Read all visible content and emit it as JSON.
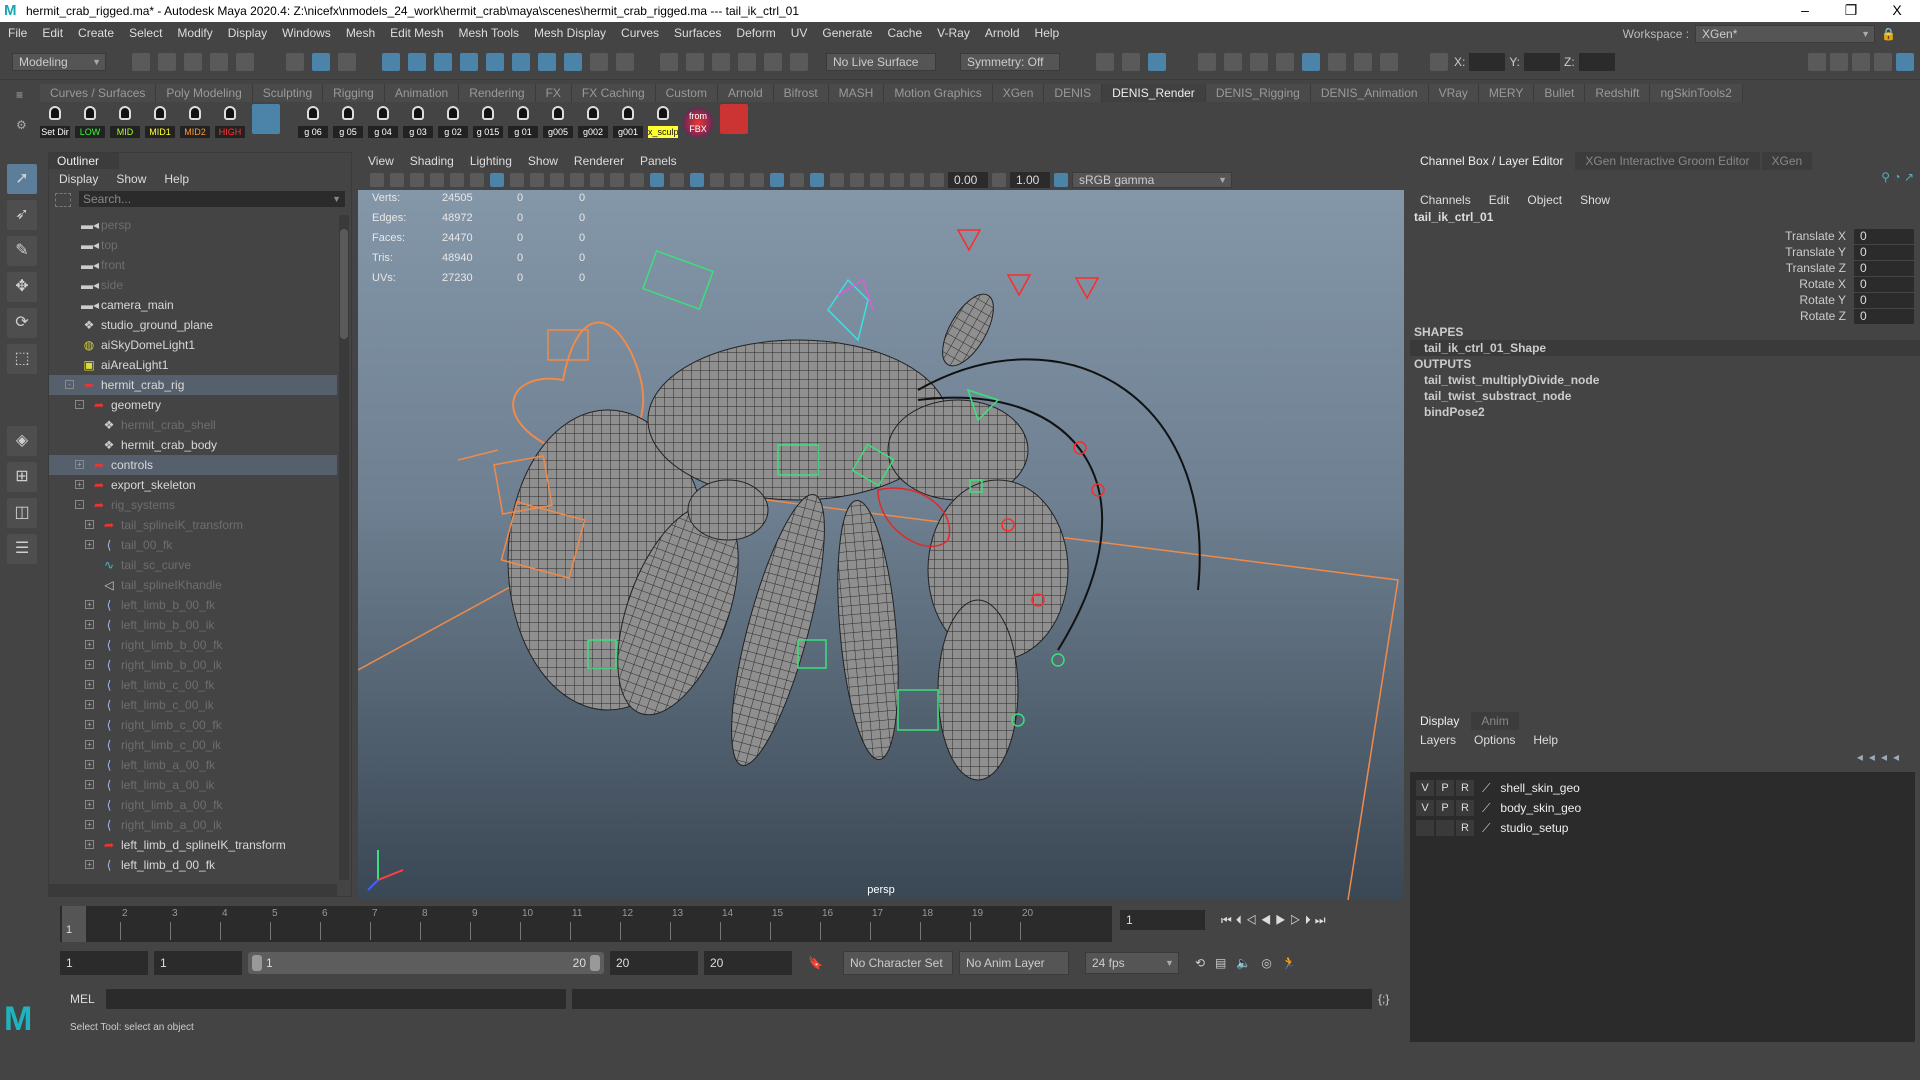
{
  "window": {
    "title": "hermit_crab_rigged.ma* - Autodesk Maya 2020.4: Z:\\nicefx\\nmodels_24_work\\hermit_crab\\maya\\scenes\\hermit_crab_rigged.ma  ---  tail_ik_ctrl_01",
    "minimize": "–",
    "restore": "❐",
    "close": "X"
  },
  "menubar": [
    "File",
    "Edit",
    "Create",
    "Select",
    "Modify",
    "Display",
    "Windows",
    "Mesh",
    "Edit Mesh",
    "Mesh Tools",
    "Mesh Display",
    "Curves",
    "Surfaces",
    "Deform",
    "UV",
    "Generate",
    "Cache",
    "V-Ray",
    "Arnold",
    "Help"
  ],
  "workspace": {
    "label": "Workspace :",
    "value": "XGen*"
  },
  "statusline": {
    "mode": "Modeling",
    "live_surface": "No Live Surface",
    "symmetry": "Symmetry: Off",
    "x_label": "X:",
    "y_label": "Y:",
    "z_label": "Z:"
  },
  "shelf_tabs": [
    "Curves / Surfaces",
    "Poly Modeling",
    "Sculpting",
    "Rigging",
    "Animation",
    "Rendering",
    "FX",
    "FX Caching",
    "Custom",
    "Arnold",
    "Bifrost",
    "MASH",
    "Motion Graphics",
    "XGen",
    "DENIS",
    "DENIS_Render",
    "DENIS_Rigging",
    "DENIS_Animation",
    "VRay",
    "MERY",
    "Bullet",
    "Redshift",
    "ngSkinTools2"
  ],
  "active_shelf": "DENIS_Render",
  "shelf_buttons": [
    {
      "label": "Set Dir",
      "color": "#ffffff"
    },
    {
      "label": "LOW",
      "color": "#33ff33"
    },
    {
      "label": "MID",
      "color": "#aaff33"
    },
    {
      "label": "MID1",
      "color": "#ffff33"
    },
    {
      "label": "MID2",
      "color": "#ff9933"
    },
    {
      "label": "HIGH",
      "color": "#ff3333"
    },
    {
      "label": "g 06",
      "color": "#ffffff"
    },
    {
      "label": "g 05",
      "color": "#ffffff"
    },
    {
      "label": "g 04",
      "color": "#ffffff"
    },
    {
      "label": "g 03",
      "color": "#ffffff"
    },
    {
      "label": "g 02",
      "color": "#ffffff"
    },
    {
      "label": "g 015",
      "color": "#ffffff"
    },
    {
      "label": "g 01",
      "color": "#ffffff"
    },
    {
      "label": "g005",
      "color": "#ffffff"
    },
    {
      "label": "g002",
      "color": "#ffffff"
    },
    {
      "label": "g001",
      "color": "#ffffff"
    },
    {
      "label": "x_sculp",
      "color": "#111111"
    },
    {
      "label": "from FBX",
      "color": "#ffffff"
    }
  ],
  "outliner": {
    "title": "Outliner",
    "menu": [
      "Display",
      "Show",
      "Help"
    ],
    "search_placeholder": "Search...",
    "items": [
      {
        "name": "persp",
        "depth": 0,
        "icon": "camera",
        "state": "dim",
        "exp": ""
      },
      {
        "name": "top",
        "depth": 0,
        "icon": "camera",
        "state": "dim",
        "exp": ""
      },
      {
        "name": "front",
        "depth": 0,
        "icon": "camera",
        "state": "dim",
        "exp": ""
      },
      {
        "name": "side",
        "depth": 0,
        "icon": "camera",
        "state": "dim",
        "exp": ""
      },
      {
        "name": "camera_main",
        "depth": 0,
        "icon": "camera",
        "state": "",
        "exp": ""
      },
      {
        "name": "studio_ground_plane",
        "depth": 0,
        "icon": "mesh",
        "state": "",
        "exp": ""
      },
      {
        "name": "aiSkyDomeLight1",
        "depth": 0,
        "icon": "skydome",
        "state": "",
        "exp": ""
      },
      {
        "name": "aiAreaLight1",
        "depth": 0,
        "icon": "arealight",
        "state": "",
        "exp": ""
      },
      {
        "name": "hermit_crab_rig",
        "depth": 0,
        "icon": "group",
        "state": "sel",
        "exp": "-"
      },
      {
        "name": "geometry",
        "depth": 1,
        "icon": "group",
        "state": "",
        "exp": "-"
      },
      {
        "name": "hermit_crab_shell",
        "depth": 2,
        "icon": "mesh",
        "state": "dim",
        "exp": ""
      },
      {
        "name": "hermit_crab_body",
        "depth": 2,
        "icon": "mesh",
        "state": "",
        "exp": ""
      },
      {
        "name": "controls",
        "depth": 1,
        "icon": "group",
        "state": "sel",
        "exp": "+"
      },
      {
        "name": "export_skeleton",
        "depth": 1,
        "icon": "group",
        "state": "",
        "exp": "+"
      },
      {
        "name": "rig_systems",
        "depth": 1,
        "icon": "group",
        "state": "dim",
        "exp": "-"
      },
      {
        "name": "tail_splineIK_transform",
        "depth": 2,
        "icon": "group",
        "state": "dim",
        "exp": "+"
      },
      {
        "name": "tail_00_fk",
        "depth": 2,
        "icon": "joint",
        "state": "dim",
        "exp": "+"
      },
      {
        "name": "tail_sc_curve",
        "depth": 2,
        "icon": "curve",
        "state": "dim",
        "exp": ""
      },
      {
        "name": "tail_splineIKhandle",
        "depth": 2,
        "icon": "ikhandle",
        "state": "dim",
        "exp": ""
      },
      {
        "name": "left_limb_b_00_fk",
        "depth": 2,
        "icon": "joint",
        "state": "dim",
        "exp": "+"
      },
      {
        "name": "left_limb_b_00_ik",
        "depth": 2,
        "icon": "joint",
        "state": "dim",
        "exp": "+"
      },
      {
        "name": "right_limb_b_00_fk",
        "depth": 2,
        "icon": "joint",
        "state": "dim",
        "exp": "+"
      },
      {
        "name": "right_limb_b_00_ik",
        "depth": 2,
        "icon": "joint",
        "state": "dim",
        "exp": "+"
      },
      {
        "name": "left_limb_c_00_fk",
        "depth": 2,
        "icon": "joint",
        "state": "dim",
        "exp": "+"
      },
      {
        "name": "left_limb_c_00_ik",
        "depth": 2,
        "icon": "joint",
        "state": "dim",
        "exp": "+"
      },
      {
        "name": "right_limb_c_00_fk",
        "depth": 2,
        "icon": "joint",
        "state": "dim",
        "exp": "+"
      },
      {
        "name": "right_limb_c_00_ik",
        "depth": 2,
        "icon": "joint",
        "state": "dim",
        "exp": "+"
      },
      {
        "name": "left_limb_a_00_fk",
        "depth": 2,
        "icon": "joint",
        "state": "dim",
        "exp": "+"
      },
      {
        "name": "left_limb_a_00_ik",
        "depth": 2,
        "icon": "joint",
        "state": "dim",
        "exp": "+"
      },
      {
        "name": "right_limb_a_00_fk",
        "depth": 2,
        "icon": "joint",
        "state": "dim",
        "exp": "+"
      },
      {
        "name": "right_limb_a_00_ik",
        "depth": 2,
        "icon": "joint",
        "state": "dim",
        "exp": "+"
      },
      {
        "name": "left_limb_d_splineIK_transform",
        "depth": 2,
        "icon": "group",
        "state": "",
        "exp": "+"
      },
      {
        "name": "left_limb_d_00_fk",
        "depth": 2,
        "icon": "joint",
        "state": "",
        "exp": "+"
      }
    ]
  },
  "viewport": {
    "menu": [
      "View",
      "Shading",
      "Lighting",
      "Show",
      "Renderer",
      "Panels"
    ],
    "exposure": "0.00",
    "gamma": "1.00",
    "color_space": "sRGB gamma",
    "camera": "persp",
    "hud": [
      {
        "label": "Verts:",
        "v": "24505",
        "a": "0",
        "b": "0"
      },
      {
        "label": "Edges:",
        "v": "48972",
        "a": "0",
        "b": "0"
      },
      {
        "label": "Faces:",
        "v": "24470",
        "a": "0",
        "b": "0"
      },
      {
        "label": "Tris:",
        "v": "48940",
        "a": "0",
        "b": "0"
      },
      {
        "label": "UVs:",
        "v": "27230",
        "a": "0",
        "b": "0"
      }
    ]
  },
  "channelbox": {
    "tabs": [
      "Channel Box / Layer Editor",
      "XGen Interactive Groom Editor",
      "XGen"
    ],
    "menu": [
      "Channels",
      "Edit",
      "Object",
      "Show"
    ],
    "object": "tail_ik_ctrl_01",
    "channels": [
      {
        "label": "Translate X",
        "value": "0"
      },
      {
        "label": "Translate Y",
        "value": "0"
      },
      {
        "label": "Translate Z",
        "value": "0"
      },
      {
        "label": "Rotate X",
        "value": "0"
      },
      {
        "label": "Rotate Y",
        "value": "0"
      },
      {
        "label": "Rotate Z",
        "value": "0"
      }
    ],
    "shapes_label": "SHAPES",
    "shapes": [
      "tail_ik_ctrl_01_Shape"
    ],
    "outputs_label": "OUTPUTS",
    "outputs": [
      "tail_twist_multiplyDivide_node",
      "tail_twist_substract_node",
      "bindPose2"
    ]
  },
  "layer_editor": {
    "tabs": [
      "Display",
      "Anim"
    ],
    "menu": [
      "Layers",
      "Options",
      "Help"
    ],
    "layers": [
      {
        "v": "V",
        "p": "P",
        "r": "R",
        "name": "shell_skin_geo"
      },
      {
        "v": "V",
        "p": "P",
        "r": "R",
        "name": "body_skin_geo"
      },
      {
        "v": "",
        "p": "",
        "r": "R",
        "name": "studio_setup"
      }
    ]
  },
  "timeline": {
    "ticks": [
      "1",
      "2",
      "3",
      "4",
      "5",
      "6",
      "7",
      "8",
      "9",
      "10",
      "11",
      "12",
      "13",
      "14",
      "15",
      "16",
      "17",
      "18",
      "19",
      "20"
    ],
    "current_frame": "1",
    "current_field": "1"
  },
  "range": {
    "start": "1",
    "playback_start": "1",
    "slider_start": "1",
    "slider_end": "20",
    "playback_end": "20",
    "end": "20",
    "character_set": "No Character Set",
    "anim_layer": "No Anim Layer",
    "fps": "24 fps"
  },
  "commandline": {
    "label": "MEL"
  },
  "helpline": "Select Tool: select an object"
}
